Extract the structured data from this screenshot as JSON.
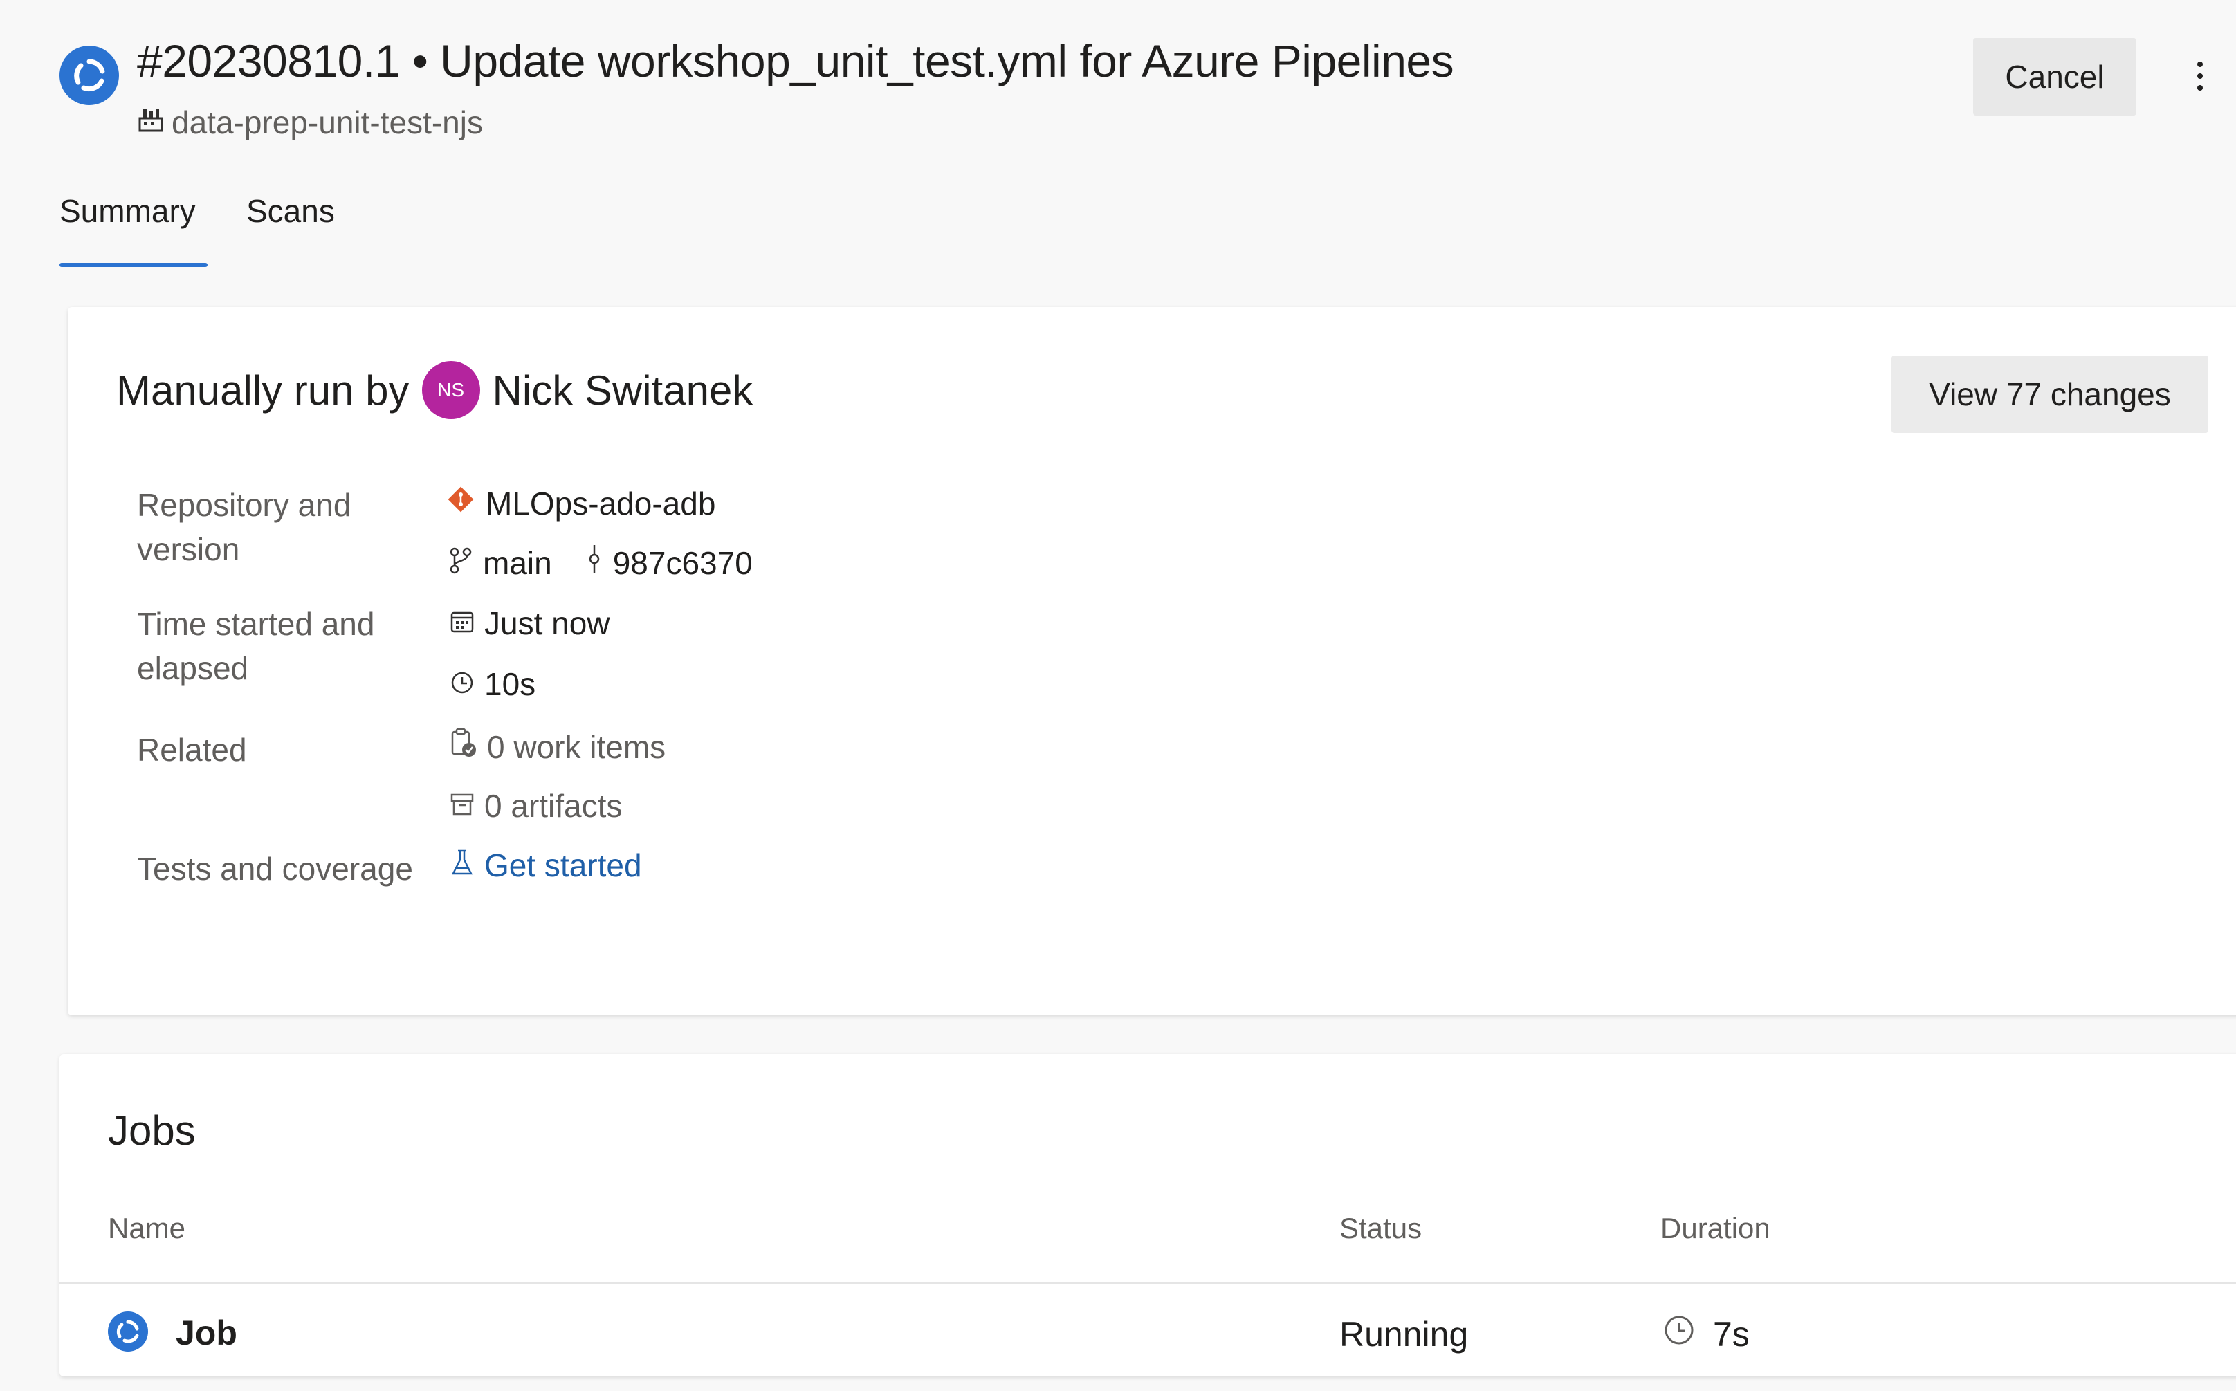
{
  "header": {
    "run_number": "#20230810.1",
    "separator": "•",
    "title": "#20230810.1 • Update workshop_unit_test.yml for Azure Pipelines",
    "pipeline_name": "data-prep-unit-test-njs",
    "cancel_label": "Cancel",
    "status": "running"
  },
  "tabs": [
    {
      "label": "Summary",
      "active": true
    },
    {
      "label": "Scans",
      "active": false
    }
  ],
  "summary": {
    "run_by_label": "Manually run by",
    "user_initials": "NS",
    "user_name": "Nick Switanek",
    "view_changes_label": "View 77 changes",
    "repo_label_line1": "Repository and",
    "repo_label_line2": "version",
    "repo_name": "MLOps-ado-adb",
    "branch": "main",
    "commit": "987c6370",
    "time_label_line1": "Time started and",
    "time_label_line2": "elapsed",
    "started": "Just now",
    "elapsed": "10s",
    "related_label": "Related",
    "work_items": "0 work items",
    "artifacts": "0 artifacts",
    "tests_label": "Tests and coverage",
    "tests_link": "Get started"
  },
  "jobs": {
    "title": "Jobs",
    "columns": {
      "name": "Name",
      "status": "Status",
      "duration": "Duration"
    },
    "rows": [
      {
        "name": "Job",
        "status": "Running",
        "duration": "7s"
      }
    ]
  },
  "colors": {
    "accent": "#2b73d1",
    "avatar": "#b4249e",
    "git_icon": "#e05a2b",
    "link": "#1f5fa8"
  }
}
